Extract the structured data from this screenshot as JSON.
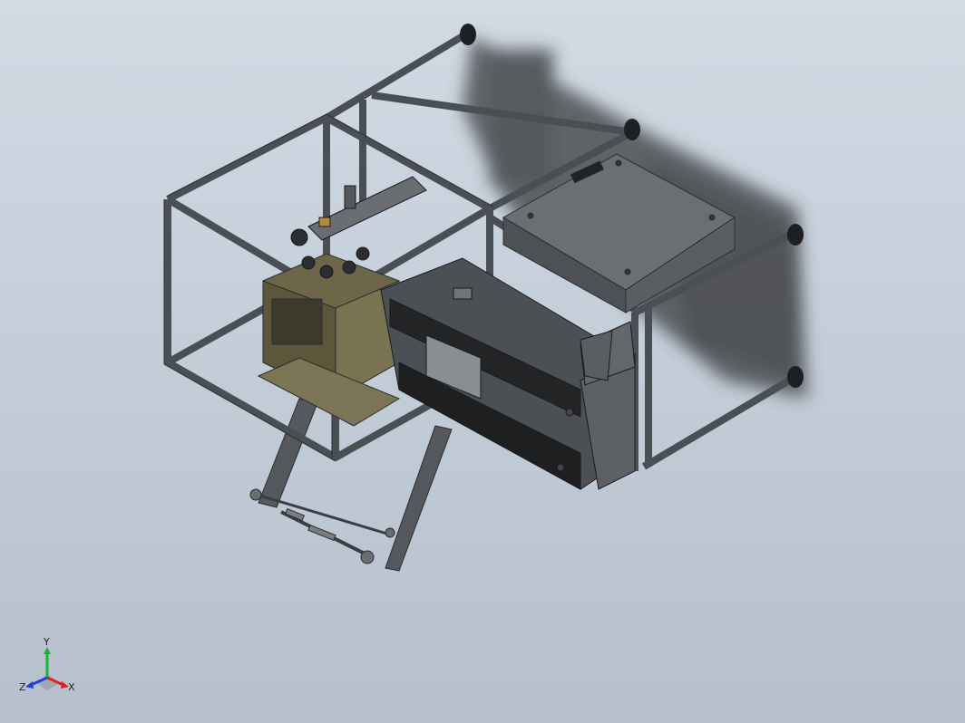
{
  "viewport": {
    "background_top": "#d2dbe4",
    "background_bottom": "#b6c0cd"
  },
  "model": {
    "frame_color": "#4a4f56",
    "frame_edge_color": "#2a2d31",
    "panel_color": "#5b5f63",
    "olive_color": "#6d6648",
    "shadow_color": "#2f3134"
  },
  "triad": {
    "x_label": "X",
    "y_label": "Y",
    "z_label": "Z",
    "x_color": "#e02020",
    "y_color": "#20b030",
    "z_color": "#2040e0"
  }
}
